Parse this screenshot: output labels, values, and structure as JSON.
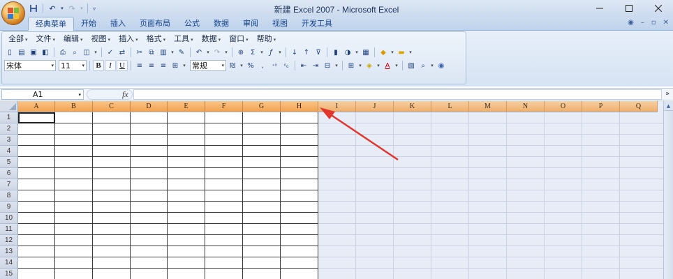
{
  "window": {
    "title": "新建 Excel 2007 - Microsoft Excel",
    "minimize_icon": "minimize-icon",
    "maximize_icon": "maximize-icon",
    "close_icon": "close-icon"
  },
  "ribbon": {
    "tabs": [
      {
        "label": "经典菜单",
        "active": true
      },
      {
        "label": "开始"
      },
      {
        "label": "插入"
      },
      {
        "label": "页面布局"
      },
      {
        "label": "公式"
      },
      {
        "label": "数据"
      },
      {
        "label": "审阅"
      },
      {
        "label": "视图"
      },
      {
        "label": "开发工具"
      }
    ]
  },
  "menu": {
    "items": [
      "全部",
      "文件",
      "编辑",
      "视图",
      "插入",
      "格式",
      "工具",
      "数据",
      "窗口",
      "帮助"
    ]
  },
  "format_toolbar": {
    "font_name": "宋体",
    "font_size": "11",
    "number_format": "常规",
    "bold": "B",
    "italic": "I",
    "underline": "U"
  },
  "formula_bar": {
    "name_box": "A1",
    "fx": "fx",
    "formula": ""
  },
  "sheet": {
    "columns": [
      "A",
      "B",
      "C",
      "D",
      "E",
      "F",
      "G",
      "H",
      "I",
      "J",
      "K",
      "L",
      "M",
      "N",
      "O",
      "P",
      "Q"
    ],
    "selected_columns": [
      "A",
      "B",
      "C",
      "D",
      "E",
      "F",
      "G",
      "H"
    ],
    "rows": [
      "1",
      "2",
      "3",
      "4",
      "5",
      "6",
      "7",
      "8",
      "9",
      "10",
      "11",
      "12",
      "13",
      "14",
      "15"
    ],
    "active_cell": "A1"
  },
  "colors": {
    "accent": "#15428b",
    "selected_header": "#f3a24f",
    "annotation_arrow": "#e2362c"
  }
}
